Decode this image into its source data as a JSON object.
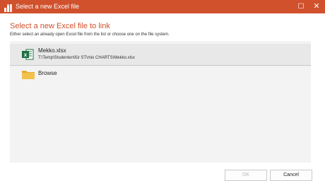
{
  "window": {
    "title": "Select a new Excel file",
    "maximize_glyph": "☐",
    "close_glyph": "✕"
  },
  "dialog": {
    "heading": "Select a new Excel file to link",
    "subtitle": "Either select an already open Excel file from the list or choose one on the file system."
  },
  "files": [
    {
      "name": "Mekko.xlsx",
      "path": "T:\\Temp\\Studenten\\für ST\\mio CHARTS\\Mekko.xlsx",
      "icon": "excel-file-icon",
      "selected": true
    }
  ],
  "browse": {
    "label": "Browse",
    "icon": "folder-icon"
  },
  "buttons": {
    "ok": "OK",
    "cancel": "Cancel",
    "ok_enabled": false
  },
  "colors": {
    "accent": "#d0512c",
    "excel_green": "#1d6f42",
    "folder": "#f2c04d"
  }
}
